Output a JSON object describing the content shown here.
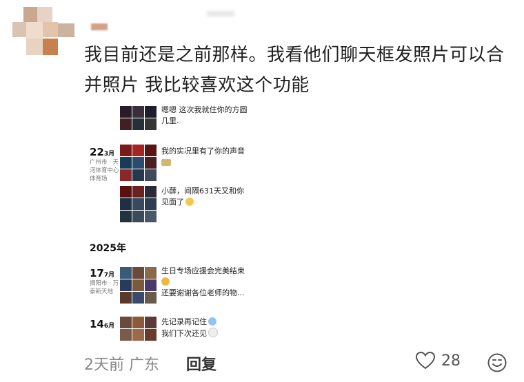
{
  "comment": {
    "text": "我目前还是之前那样。我看他们聊天框发照片可以合并照片 我比较喜欢这个功能"
  },
  "embedded": {
    "top_partial_text": "嗯嗯 这次我就住你的方圆几里.",
    "entries": [
      {
        "day": "22",
        "month": "3月",
        "location": "广州市 · 天河体育中心体育场",
        "text": "我的实况里有了你的声音",
        "emoji": "sun-emoji"
      },
      {
        "day": "",
        "month": "",
        "location": "",
        "text": "小薛，间隔631天又和你见面了",
        "emoji": "smile-emoji"
      }
    ],
    "year": "2025年",
    "entries_2025": [
      {
        "day": "17",
        "month": "7月",
        "location": "揭阳市 · 万泰新天地",
        "text_line1": "生日专场应援会完美结束",
        "text_line2": "还要谢谢各位老师的物..."
      },
      {
        "day": "14",
        "month": "6月",
        "location": "",
        "text_line1": "先记录再记住",
        "text_line2": "我们下次还见"
      }
    ]
  },
  "footer": {
    "time_location": "2天前 广东",
    "reply_label": "回复",
    "like_count": "28"
  },
  "icons": {
    "like": "heart-outline-icon",
    "emoji": "smiley-face-icon"
  },
  "colors": {
    "text": "#222222",
    "meta": "#888888",
    "reply": "#333333"
  }
}
